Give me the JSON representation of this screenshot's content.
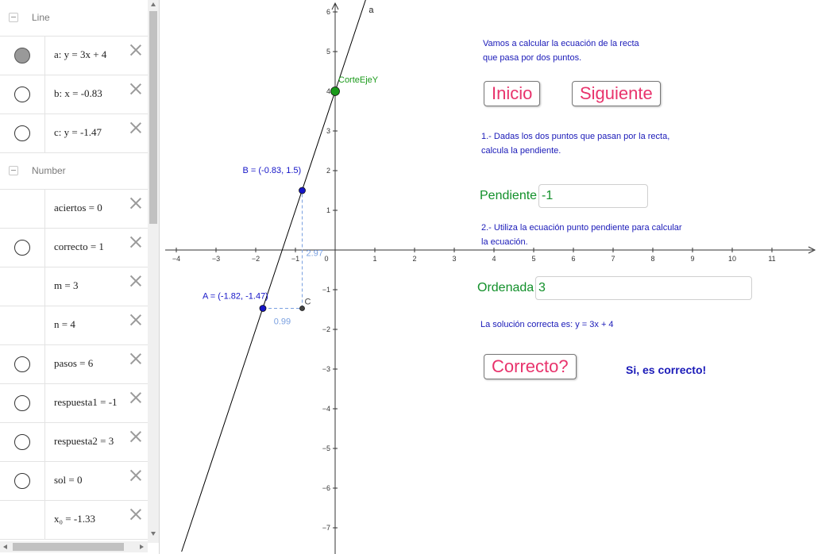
{
  "algebra": {
    "groups": [
      {
        "title": "Line",
        "top": 0,
        "rows": [
          {
            "name": "a",
            "formula": "a: y = 3x + 4",
            "marble": "on"
          },
          {
            "name": "b",
            "formula": "b: x = -0.83",
            "marble": "off"
          },
          {
            "name": "c",
            "formula": "c: y = -1.47",
            "marble": "off"
          }
        ]
      },
      {
        "title": "Number",
        "rows": [
          {
            "name": "aciertos",
            "formula": "aciertos = 0",
            "marble": "none"
          },
          {
            "name": "correcto",
            "formula": "correcto = 1",
            "marble": "off"
          },
          {
            "name": "m",
            "formula": "m = 3",
            "marble": "none"
          },
          {
            "name": "n",
            "formula": "n = 4",
            "marble": "none"
          },
          {
            "name": "pasos",
            "formula": "pasos = 6",
            "marble": "off"
          },
          {
            "name": "respuesta1",
            "formula": "respuesta1 = -1",
            "marble": "off"
          },
          {
            "name": "respuesta2",
            "formula": "respuesta2 = 3",
            "marble": "off"
          },
          {
            "name": "sol",
            "formula": "sol = 0",
            "marble": "off"
          },
          {
            "name": "x0",
            "formula": "x₀ = -1.33",
            "marble": "none"
          }
        ]
      }
    ]
  },
  "graphics": {
    "axes": {
      "x_ticks": [
        -4,
        -3,
        -2,
        -1,
        0,
        1,
        2,
        3,
        4,
        5,
        6,
        7,
        8,
        9,
        10,
        11
      ],
      "y_ticks": [
        -7,
        -6,
        -5,
        -4,
        -3,
        -2,
        -1,
        1,
        2,
        3,
        4,
        5,
        6
      ],
      "xrange": [
        -4.3,
        12.1
      ],
      "yrange": [
        -7.6,
        6.3
      ]
    },
    "line_a": {
      "label": "a",
      "slope": 3,
      "intercept": 4,
      "color": "#000000"
    },
    "points": [
      {
        "id": "A",
        "x": -1.82,
        "y": -1.47,
        "label": "A = (-1.82, -1.47)",
        "color": "#1515c8"
      },
      {
        "id": "B",
        "x": -0.83,
        "y": 1.5,
        "label": "B = (-0.83, 1.5)",
        "color": "#1515c8"
      },
      {
        "id": "C",
        "x": -0.83,
        "y": -1.47,
        "label": "C",
        "color": "#444444"
      },
      {
        "id": "CorteEjeY",
        "x": 0,
        "y": 4,
        "label": "CorteEjeY",
        "color": "#1a9a1a"
      }
    ],
    "slope_triangle": {
      "dx_label": "0.99",
      "dy_label": "2.97",
      "color": "#7aa0e0"
    },
    "intro_line1": "Vamos a calcular la ecuación de la recta",
    "intro_line2": "que pasa por dos puntos.",
    "btn_inicio": "Inicio",
    "btn_siguiente": "Siguiente",
    "step1_line1": "1.- Dadas los dos puntos que pasan por la recta,",
    "step1_line2": "calcula la pendiente.",
    "pendiente_label": "Pendiente",
    "pendiente_value": "-1",
    "step2_line1": "2.- Utiliza la ecuación punto pendiente para calcular",
    "step2_line2": "la ecuación.",
    "ordenada_label": "Ordenada",
    "ordenada_value": "3",
    "solucion_text": "La solución correcta es: y = 3x + 4",
    "btn_correcto": "Correcto?",
    "result_text": "Si, es correcto!",
    "colors": {
      "button_text": "#e8336c",
      "green": "#12902a",
      "blue_text": "#1a1ab8"
    }
  }
}
